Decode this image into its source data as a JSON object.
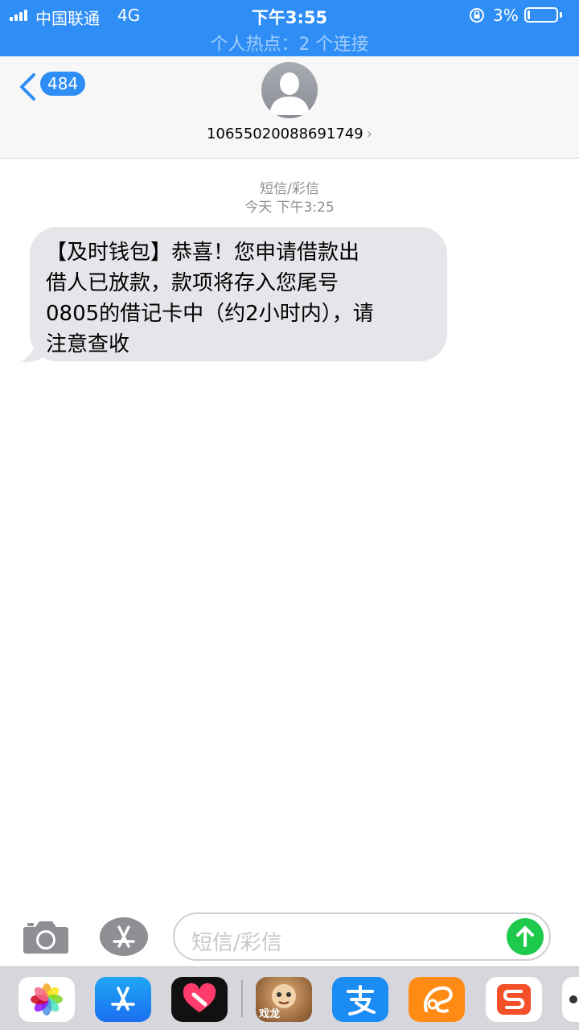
{
  "status_bar": {
    "carrier": "中国联通",
    "network": "4G",
    "time": "下午3:55",
    "battery_percent": "3%",
    "battery_level": 0.03,
    "hotspot_text": "个人热点：2 个连接"
  },
  "nav": {
    "unread_count": "484",
    "contact_number": "10655020088691749"
  },
  "conversation": {
    "message_type": "短信/彩信",
    "timestamp": "今天 下午3:25",
    "message_lines": [
      "【及时钱包】恭喜！您申请借款出",
      "借人已放款，款项将存入您尾号",
      "0805的借记卡中（约2小时内），请",
      "注意查收"
    ]
  },
  "input": {
    "placeholder": "短信/彩信"
  },
  "app_drawer": {
    "game_icon_text": "戏龙",
    "apps": [
      "photos-icon",
      "app-store-icon",
      "heart-app-icon",
      "game-app-icon",
      "alipay-icon",
      "uc-browser-icon",
      "sogou-input-icon",
      "more-icon"
    ]
  },
  "colors": {
    "status_bar_bg": "#2e8ef6",
    "badge_bg": "#2e8ef6",
    "bubble_bg": "#e5e5ea",
    "send_button": "#1ec94b",
    "drawer_bg": "#d6d7dc"
  }
}
